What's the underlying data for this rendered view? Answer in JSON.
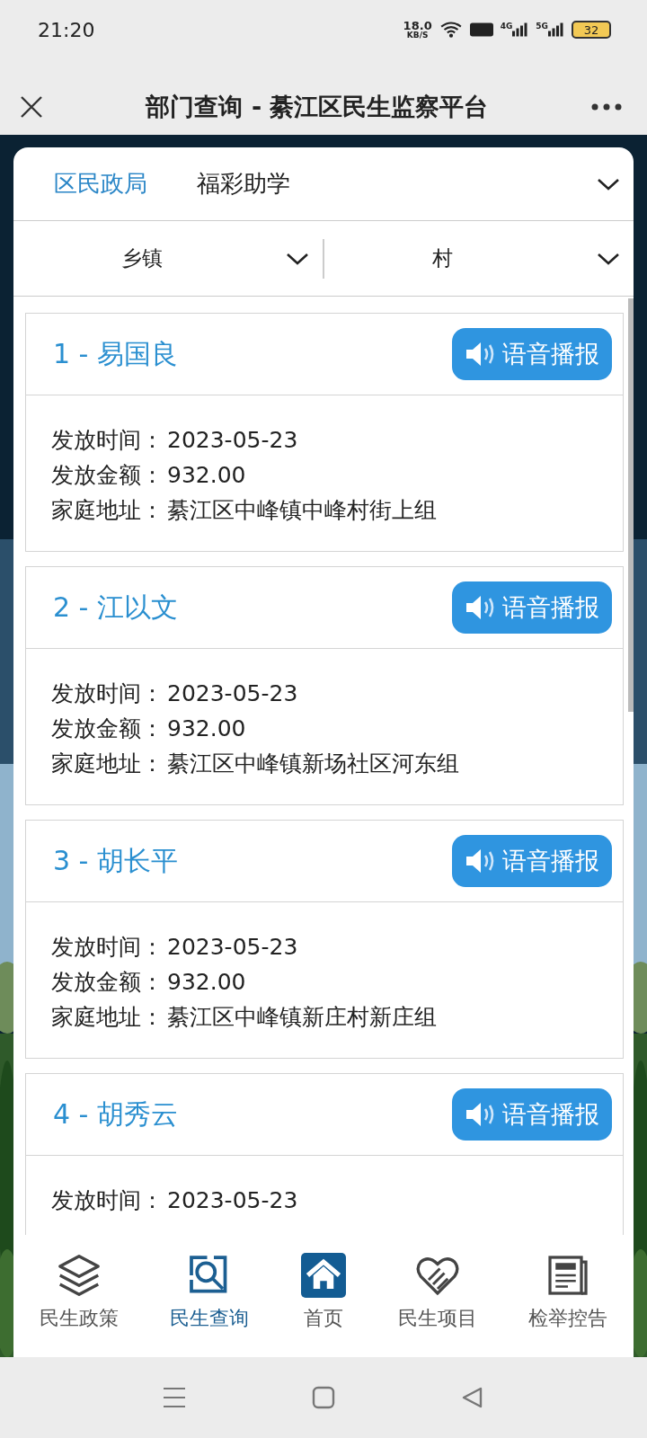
{
  "status_bar": {
    "time": "21:20",
    "speed": "18.0",
    "speed_unit": "KB/S",
    "networks": [
      "4G",
      "5G"
    ],
    "battery": "32"
  },
  "title_bar": {
    "title": "部门查询 - 綦江区民生监察平台"
  },
  "department": "区民政局",
  "category": "福彩助学",
  "filters": [
    {
      "label": "乡镇"
    },
    {
      "label": "村"
    }
  ],
  "records": [
    {
      "title": "1 - 易国良",
      "button": "语音播报",
      "fields": [
        {
          "label": "发放时间：",
          "value": "2023-05-23"
        },
        {
          "label": "发放金额：",
          "value": "932.00"
        },
        {
          "label": "家庭地址：",
          "value": "綦江区中峰镇中峰村街上组"
        }
      ]
    },
    {
      "title": "2 - 江以文",
      "button": "语音播报",
      "fields": [
        {
          "label": "发放时间：",
          "value": "2023-05-23"
        },
        {
          "label": "发放金额：",
          "value": "932.00"
        },
        {
          "label": "家庭地址：",
          "value": "綦江区中峰镇新场社区河东组"
        }
      ]
    },
    {
      "title": "3 - 胡长平",
      "button": "语音播报",
      "fields": [
        {
          "label": "发放时间：",
          "value": "2023-05-23"
        },
        {
          "label": "发放金额：",
          "value": "932.00"
        },
        {
          "label": "家庭地址：",
          "value": "綦江区中峰镇新庄村新庄组"
        }
      ]
    },
    {
      "title": "4 - 胡秀云",
      "button": "语音播报",
      "fields": [
        {
          "label": "发放时间：",
          "value": "2023-05-23"
        }
      ]
    }
  ],
  "bottom_nav": [
    {
      "label": "民生政策",
      "kind": "layers",
      "selected": false
    },
    {
      "label": "民生查询",
      "kind": "search",
      "selected": true
    },
    {
      "label": "首页",
      "kind": "home",
      "selected": false
    },
    {
      "label": "民生项目",
      "kind": "handshake",
      "selected": false
    },
    {
      "label": "检举控告",
      "kind": "news",
      "selected": false
    }
  ]
}
